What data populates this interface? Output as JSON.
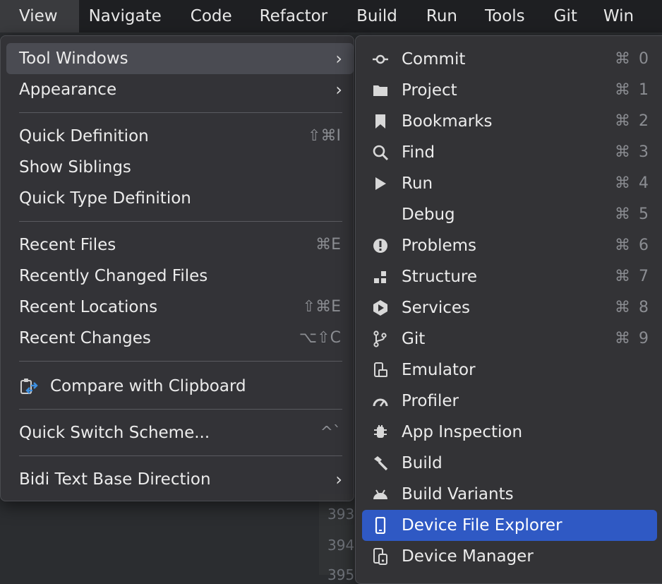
{
  "menubar": {
    "items": [
      "View",
      "Navigate",
      "Code",
      "Refactor",
      "Build",
      "Run",
      "Tools",
      "Git",
      "Win"
    ],
    "active": "View"
  },
  "view_menu": {
    "items": [
      {
        "label": "Tool Windows",
        "shortcut": "",
        "submenu": true,
        "highlighted": true
      },
      {
        "label": "Appearance",
        "shortcut": "",
        "submenu": true
      },
      {
        "label": "Quick Definition",
        "shortcut": "⇧⌘I"
      },
      {
        "label": "Show Siblings",
        "shortcut": ""
      },
      {
        "label": "Quick Type Definition",
        "shortcut": ""
      },
      {
        "label": "Recent Files",
        "shortcut": "⌘E"
      },
      {
        "label": "Recently Changed Files",
        "shortcut": ""
      },
      {
        "label": "Recent Locations",
        "shortcut": "⇧⌘E"
      },
      {
        "label": "Recent Changes",
        "shortcut": "⌥⇧C"
      },
      {
        "label": "Compare with Clipboard",
        "shortcut": "",
        "icon": "clipboard-compare-icon"
      },
      {
        "label": "Quick Switch Scheme...",
        "shortcut": "^`"
      },
      {
        "label": "Bidi Text Base Direction",
        "shortcut": "",
        "submenu": true
      }
    ]
  },
  "tool_windows": {
    "items": [
      {
        "label": "Commit",
        "key": "⌘",
        "num": "0",
        "icon": "commit-icon"
      },
      {
        "label": "Project",
        "key": "⌘",
        "num": "1",
        "icon": "folder-icon"
      },
      {
        "label": "Bookmarks",
        "key": "⌘",
        "num": "2",
        "icon": "bookmark-icon"
      },
      {
        "label": "Find",
        "key": "⌘",
        "num": "3",
        "icon": "search-icon"
      },
      {
        "label": "Run",
        "key": "⌘",
        "num": "4",
        "icon": "play-icon"
      },
      {
        "label": "Debug",
        "key": "⌘",
        "num": "5",
        "icon": ""
      },
      {
        "label": "Problems",
        "key": "⌘",
        "num": "6",
        "icon": "problems-icon"
      },
      {
        "label": "Structure",
        "key": "⌘",
        "num": "7",
        "icon": "structure-icon"
      },
      {
        "label": "Services",
        "key": "⌘",
        "num": "8",
        "icon": "services-icon"
      },
      {
        "label": "Git",
        "key": "⌘",
        "num": "9",
        "icon": "git-branch-icon"
      },
      {
        "label": "Emulator",
        "key": "",
        "num": "",
        "icon": "emulator-icon"
      },
      {
        "label": "Profiler",
        "key": "",
        "num": "",
        "icon": "gauge-icon"
      },
      {
        "label": "App Inspection",
        "key": "",
        "num": "",
        "icon": "inspection-icon"
      },
      {
        "label": "Build",
        "key": "",
        "num": "",
        "icon": "hammer-icon"
      },
      {
        "label": "Build Variants",
        "key": "",
        "num": "",
        "icon": "android-icon"
      },
      {
        "label": "Device File Explorer",
        "key": "",
        "num": "",
        "icon": "phone-icon",
        "selected": true
      },
      {
        "label": "Device Manager",
        "key": "",
        "num": "",
        "icon": "device-manager-icon"
      }
    ]
  },
  "editor": {
    "line_numbers": [
      "393",
      "394",
      "395"
    ]
  },
  "colors": {
    "selection": "#2f59c4",
    "menu_bg": "#343437",
    "menubar_bg": "#1e1f22"
  }
}
